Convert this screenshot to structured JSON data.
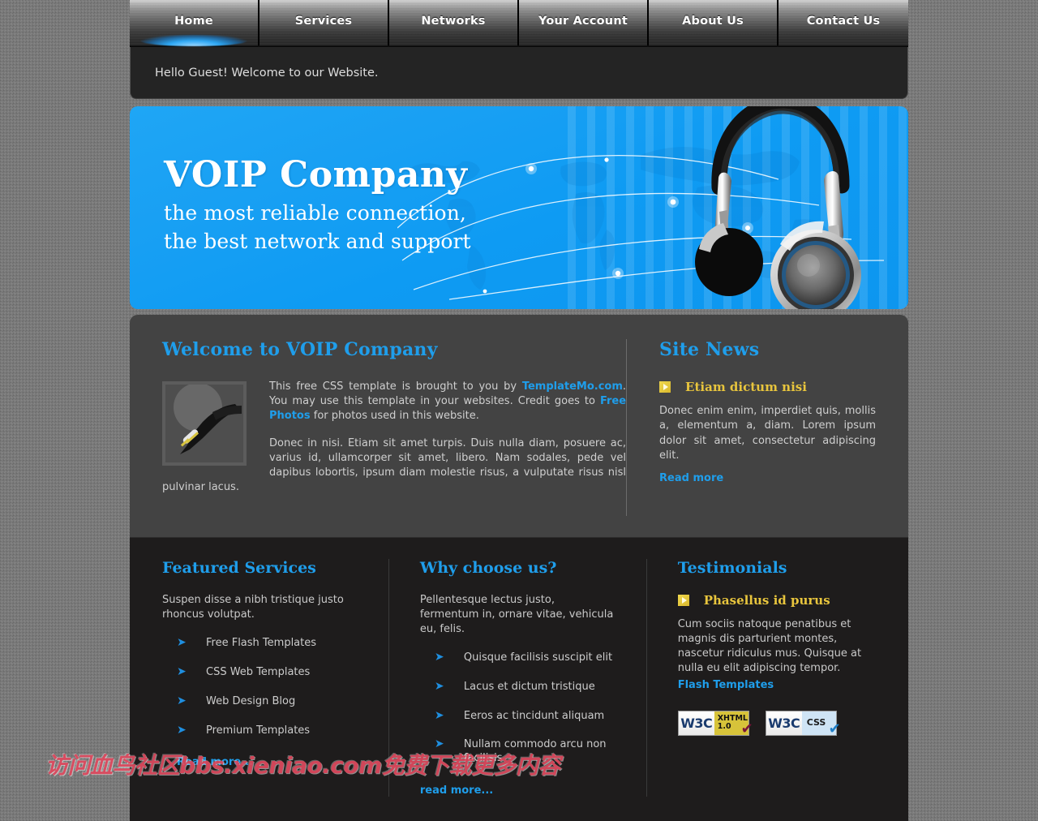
{
  "nav": {
    "items": [
      {
        "label": "Home",
        "active": true
      },
      {
        "label": "Services",
        "active": false
      },
      {
        "label": "Networks",
        "active": false
      },
      {
        "label": "Your Account",
        "active": false
      },
      {
        "label": "About Us",
        "active": false
      },
      {
        "label": "Contact Us",
        "active": false
      }
    ]
  },
  "greeting": {
    "text": "Hello Guest! Welcome to our Website."
  },
  "banner": {
    "title": "VOIP Company",
    "subtitle_line1": "the most reliable connection,",
    "subtitle_line2": "the best network and support",
    "bg_color": "#0d96ef",
    "image_alt": "headphones"
  },
  "welcome": {
    "heading": "Welcome to VOIP Company",
    "thumb_alt": "audio-jack-cable",
    "paragraph1_part1": "This free CSS template is brought to you by ",
    "paragraph1_link1": "TemplateMo.com",
    "paragraph1_part2": ". You may use this template in your websites. Credit goes to ",
    "paragraph1_link2": "Free Photos",
    "paragraph1_part3": " for photos used in this website.",
    "paragraph2": "Donec in nisi. Etiam sit amet turpis. Duis nulla diam, posuere ac, varius id, ullamcorper sit amet, libero. Nam sodales, pede vel dapibus lobortis, ipsum diam molestie risus, a vulputate risus nisl pulvinar lacus."
  },
  "site_news": {
    "heading": "Site News",
    "item_title": "Etiam dictum nisi",
    "item_body": "Donec enim enim, imperdiet quis, mollis a, elementum a, diam. Lorem ipsum dolor sit amet, consectetur adipiscing elit.",
    "read_more": "Read more"
  },
  "featured_services": {
    "heading": "Featured Services",
    "lead": "Suspen disse a nibh tristique justo rhoncus volutpat.",
    "items": [
      "Free Flash Templates",
      "CSS Web Templates",
      "Web Design Blog",
      "Premium Templates"
    ],
    "read_more": "Read more..."
  },
  "why_choose": {
    "heading": "Why choose us?",
    "lead": "Pellentesque lectus justo, fermentum in, ornare vitae, vehicula eu, felis.",
    "items": [
      "Quisque facilisis suscipit elit",
      "Lacus et dictum tristique",
      "Eeros ac tincidunt aliquam",
      "Nullam commodo arcu non facilisis"
    ],
    "read_more": "read more..."
  },
  "testimonials": {
    "heading": "Testimonials",
    "item_title": "Phasellus id purus",
    "item_body": "Cum sociis natoque penatibus et magnis dis parturient montes, nascetur ridiculus mus. Quisque at nulla eu elit adipiscing tempor.",
    "link": "Flash Templates",
    "badges": [
      {
        "mark": "W3C",
        "label_line1": "XHTML",
        "label_line2": "1.0",
        "tick": "✔"
      },
      {
        "mark": "W3C",
        "label_line1": "CSS",
        "label_line2": "",
        "tick": "✔"
      }
    ]
  },
  "watermark": {
    "text": "访问血鸟社区bbs.xieniao.com免费下载更多内容"
  },
  "colors": {
    "accent_blue": "#1f9eeb",
    "banner_blue": "#0d96ef",
    "news_gold": "#e8c53d",
    "panel_light": "#434343",
    "panel_dark": "#1e1c1c"
  }
}
